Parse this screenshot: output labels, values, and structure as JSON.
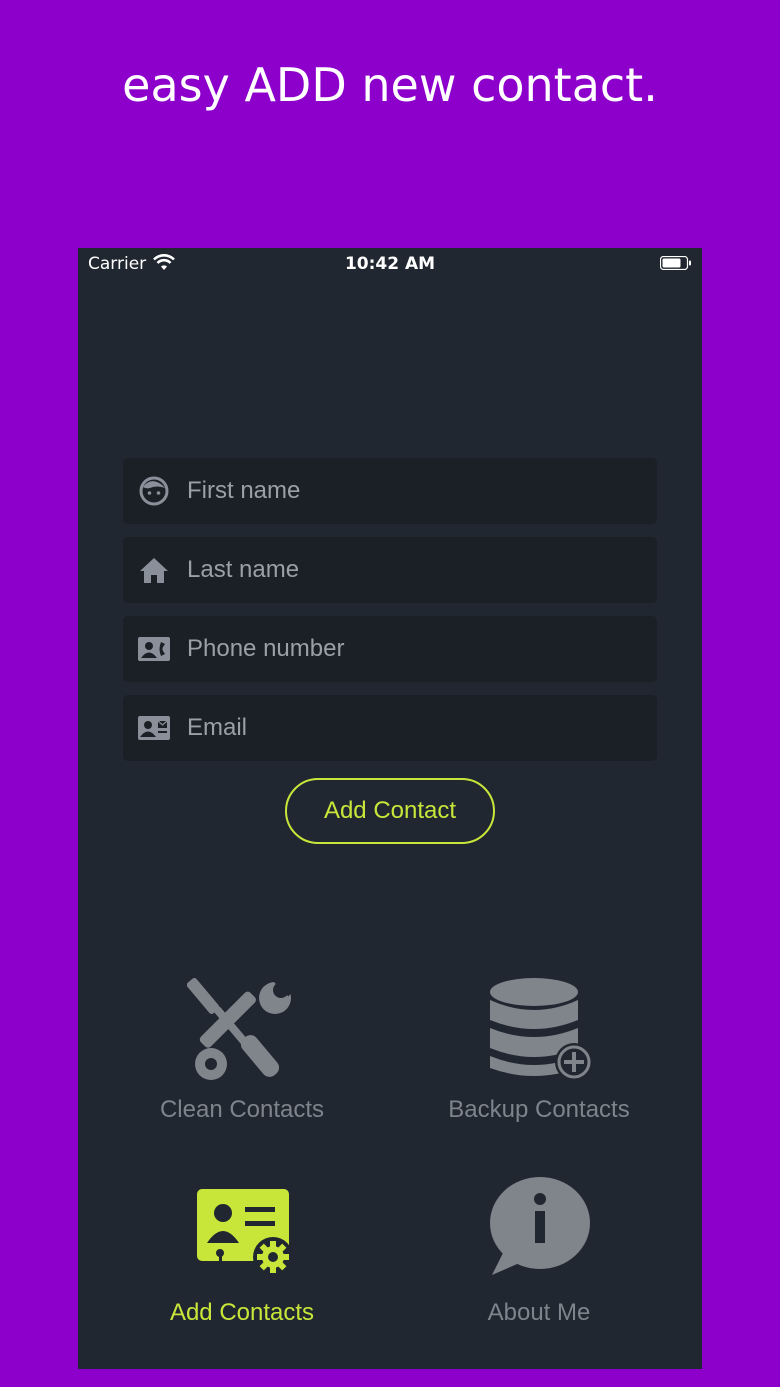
{
  "headline": "easy ADD new contact.",
  "status_bar": {
    "carrier": "Carrier",
    "time": "10:42 AM",
    "wifi_icon": "wifi-icon",
    "battery_icon": "battery-icon"
  },
  "form": {
    "fields": [
      {
        "placeholder": "First name",
        "value": "",
        "icon": "face-icon"
      },
      {
        "placeholder": "Last name",
        "value": "",
        "icon": "home-icon"
      },
      {
        "placeholder": "Phone number",
        "value": "",
        "icon": "contact-card-phone-icon"
      },
      {
        "placeholder": "Email",
        "value": "",
        "icon": "contact-card-mail-icon"
      }
    ],
    "submit_label": "Add Contact"
  },
  "menu": {
    "items": [
      {
        "label": "Clean Contacts",
        "icon": "tools-icon",
        "active": false
      },
      {
        "label": "Backup Contacts",
        "icon": "database-add-icon",
        "active": false
      },
      {
        "label": "Add Contacts",
        "icon": "contact-card-gear-icon",
        "active": true
      },
      {
        "label": "About Me",
        "icon": "info-bubble-icon",
        "active": false
      }
    ]
  },
  "colors": {
    "page_background": "#8d00cc",
    "screen_background": "#212730",
    "field_background": "#1b1f26",
    "accent": "#c8e63a",
    "muted": "#7e848c"
  }
}
